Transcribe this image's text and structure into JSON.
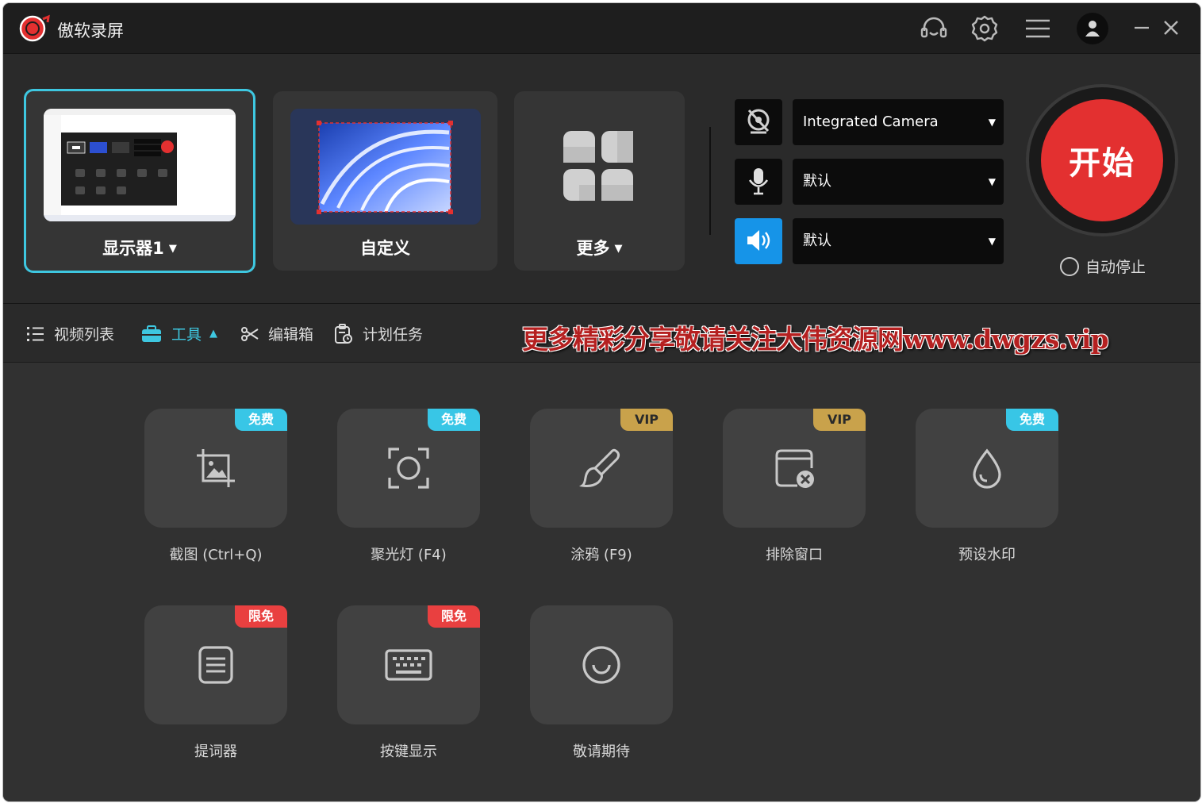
{
  "app": {
    "title": "傲软录屏"
  },
  "sources": [
    {
      "label": "显示器1",
      "has_dropdown": true,
      "active": true
    },
    {
      "label": "自定义",
      "has_dropdown": false,
      "active": false
    },
    {
      "label": "更多",
      "has_dropdown": true,
      "active": false
    }
  ],
  "devices": {
    "camera": {
      "value": "Integrated Camera",
      "icon": "camera-off-icon"
    },
    "microphone": {
      "value": "默认",
      "icon": "microphone-icon"
    },
    "speaker": {
      "value": "默认",
      "icon": "speaker-icon"
    }
  },
  "start": {
    "label": "开始",
    "auto_stop_label": "自动停止"
  },
  "toolbar": {
    "tabs": [
      {
        "label": "视频列表",
        "icon": "list-icon"
      },
      {
        "label": "工具",
        "icon": "toolbox-icon",
        "active": true
      },
      {
        "label": "编辑箱",
        "icon": "scissors-icon"
      },
      {
        "label": "计划任务",
        "icon": "schedule-icon"
      }
    ],
    "watermark": "更多精彩分享敬请关注大伟资源网www.dwgzs.vip"
  },
  "tools": [
    {
      "label": "截图 (Ctrl+Q)",
      "badge": "免费",
      "icon": "screenshot-icon"
    },
    {
      "label": "聚光灯 (F4)",
      "badge": "免费",
      "icon": "spotlight-icon"
    },
    {
      "label": "涂鸦 (F9)",
      "badge": "VIP",
      "icon": "brush-icon"
    },
    {
      "label": "排除窗口",
      "badge": "VIP",
      "icon": "exclude-window-icon"
    },
    {
      "label": "预设水印",
      "badge": "免费",
      "icon": "watermark-drop-icon"
    },
    {
      "label": "提词器",
      "badge": "限免",
      "icon": "teleprompter-icon"
    },
    {
      "label": "按键显示",
      "badge": "限免",
      "icon": "keyboard-icon"
    },
    {
      "label": "敬请期待",
      "badge": "",
      "icon": "loading-icon"
    }
  ],
  "colors": {
    "accent": "#3ec7e0",
    "start": "#e33030",
    "vip": "#c9a24b",
    "limited": "#e94040",
    "free": "#38c6e6"
  }
}
